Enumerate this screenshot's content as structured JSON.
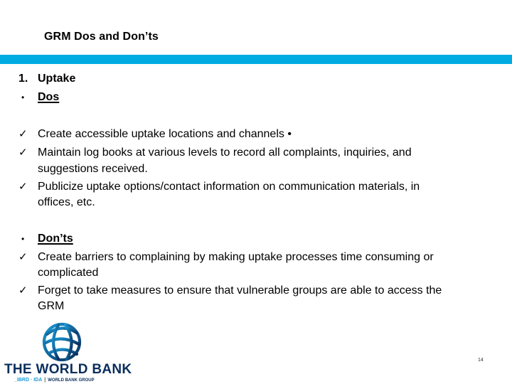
{
  "slide": {
    "title": "GRM Dos and Don’ts",
    "accent_color": "#00ace2",
    "page_number": "14"
  },
  "section": {
    "number": "1.",
    "heading": "Uptake"
  },
  "dos": {
    "bullet": "•",
    "heading": "Dos",
    "items": [
      {
        "lines": [
          "Create accessible uptake locations and channels •"
        ]
      },
      {
        "lines": [
          "Maintain log books at various levels to record all complaints, inquiries, and",
          "suggestions received."
        ]
      },
      {
        "lines": [
          "Publicize uptake options/contact information on communication materials, in",
          "offices, etc."
        ]
      }
    ]
  },
  "donts": {
    "bullet": "•",
    "heading": "Don’ts",
    "items": [
      {
        "lines": [
          "Create barriers to complaining by making uptake processes time consuming or",
          "complicated"
        ]
      },
      {
        "lines": [
          "Forget to take measures to ensure that vulnerable groups are able to access the",
          "GRM"
        ]
      }
    ]
  },
  "icons": {
    "check": "✓"
  },
  "logo": {
    "name": "THE WORLD BANK",
    "sub_ibrd": "_IBRD · IDA",
    "sub_sep": "|",
    "sub_group": "WORLD BANK GROUP",
    "globe_color_light": "#1a9bd7",
    "globe_color_dark": "#0a2d5c"
  }
}
